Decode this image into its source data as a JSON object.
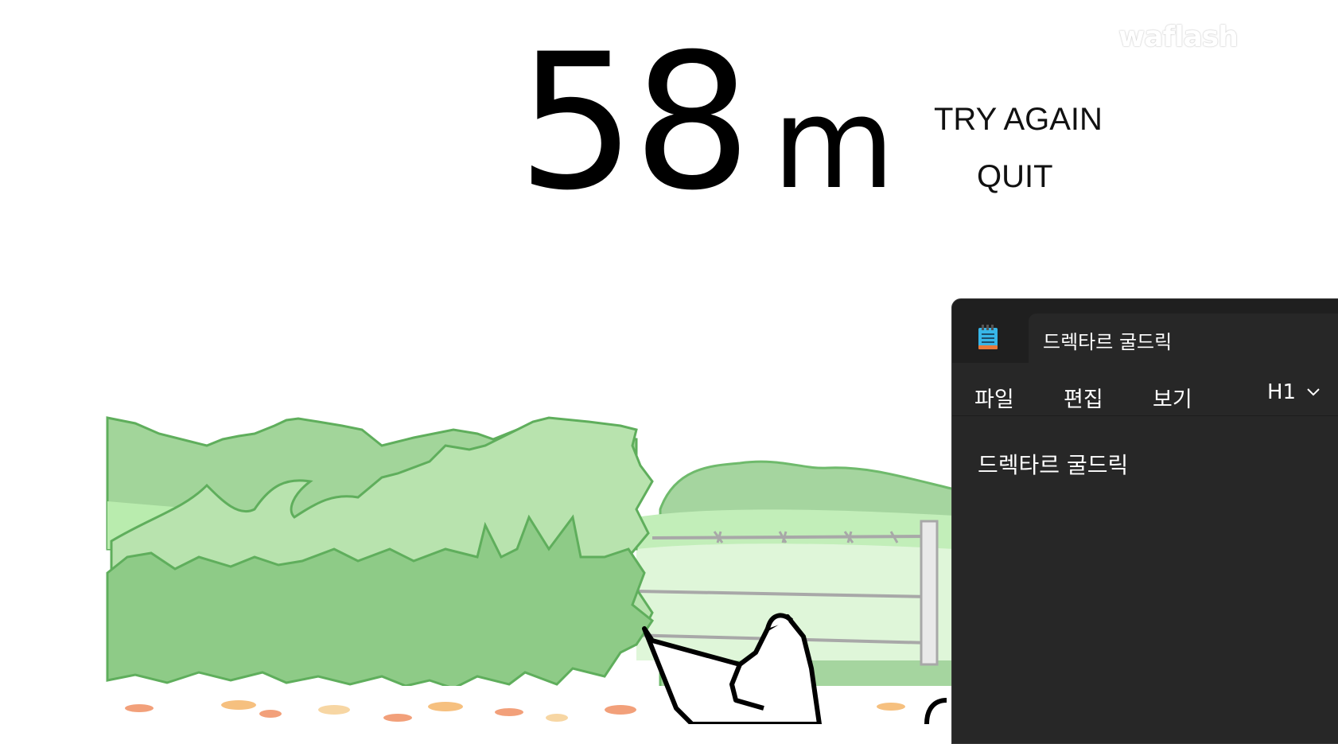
{
  "game": {
    "distance_value": "58",
    "distance_unit": "m",
    "buttons": {
      "try_again": "TRY AGAIN",
      "quit": "QUIT"
    },
    "watermark": "waflash",
    "colors": {
      "bush_dark": "#8ecb87",
      "bush_light": "#b9e3b0",
      "bush_outline": "#5fae5c",
      "hill": "#a5d59f",
      "grass": "#c9efc0",
      "fence": "#a8a8a8",
      "leaves": [
        "#f2a07a",
        "#f6c07f",
        "#f7d6a3"
      ]
    }
  },
  "notepad": {
    "tab_title": "드렉타르 굴드릭",
    "menu": {
      "file": "파일",
      "edit": "편집",
      "view": "보기",
      "heading": "H1"
    },
    "content": "드렉타르 굴드릭",
    "icons": {
      "app": "notepad-icon",
      "dropdown": "chevron-down-icon"
    },
    "colors": {
      "background": "#272727",
      "titlebar": "#1f1f1f",
      "text": "#ffffff"
    }
  }
}
